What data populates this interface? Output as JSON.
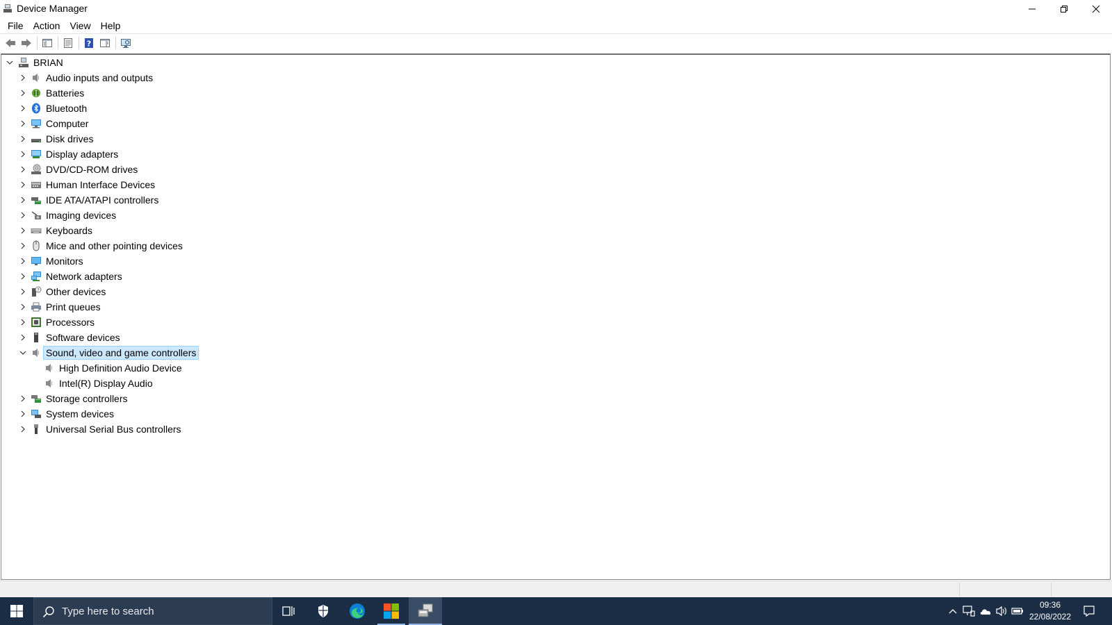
{
  "window": {
    "title": "Device Manager",
    "icon": "device-manager-icon"
  },
  "menu": {
    "items": [
      "File",
      "Action",
      "View",
      "Help"
    ]
  },
  "toolbar": {
    "buttons": [
      "back-arrow-icon",
      "forward-arrow-icon",
      "show-hide-console-tree-icon",
      "properties-icon",
      "help-icon",
      "show-action-pane-icon",
      "scan-hardware-icon"
    ]
  },
  "tree": {
    "root": {
      "label": "BRIAN",
      "icon": "computer-root-icon",
      "expanded": true
    },
    "categories": [
      {
        "label": "Audio inputs and outputs",
        "icon": "speaker-icon"
      },
      {
        "label": "Batteries",
        "icon": "battery-icon"
      },
      {
        "label": "Bluetooth",
        "icon": "bluetooth-icon"
      },
      {
        "label": "Computer",
        "icon": "computer-icon"
      },
      {
        "label": "Disk drives",
        "icon": "disk-drive-icon"
      },
      {
        "label": "Display adapters",
        "icon": "display-adapter-icon"
      },
      {
        "label": "DVD/CD-ROM drives",
        "icon": "dvd-drive-icon"
      },
      {
        "label": "Human Interface Devices",
        "icon": "hid-icon"
      },
      {
        "label": "IDE ATA/ATAPI controllers",
        "icon": "ide-controller-icon"
      },
      {
        "label": "Imaging devices",
        "icon": "camera-icon"
      },
      {
        "label": "Keyboards",
        "icon": "keyboard-icon"
      },
      {
        "label": "Mice and other pointing devices",
        "icon": "mouse-icon"
      },
      {
        "label": "Monitors",
        "icon": "monitor-icon"
      },
      {
        "label": "Network adapters",
        "icon": "network-adapter-icon"
      },
      {
        "label": "Other devices",
        "icon": "unknown-device-icon"
      },
      {
        "label": "Print queues",
        "icon": "printer-icon"
      },
      {
        "label": "Processors",
        "icon": "processor-icon"
      },
      {
        "label": "Software devices",
        "icon": "software-device-icon"
      },
      {
        "label": "Sound, video and game controllers",
        "icon": "speaker-icon",
        "expanded": true,
        "selected": true,
        "children": [
          {
            "label": "High Definition Audio Device",
            "icon": "speaker-icon"
          },
          {
            "label": "Intel(R) Display Audio",
            "icon": "speaker-icon"
          }
        ]
      },
      {
        "label": "Storage controllers",
        "icon": "storage-controller-icon"
      },
      {
        "label": "System devices",
        "icon": "system-device-icon"
      },
      {
        "label": "Universal Serial Bus controllers",
        "icon": "usb-icon"
      }
    ]
  },
  "taskbar": {
    "search_placeholder": "Type here to search",
    "time": "09:36",
    "date": "22/08/2022",
    "apps": [
      "start-icon",
      "task-view-icon",
      "security-shield-icon",
      "edge-icon",
      "store-icon",
      "device-manager-taskbar-icon"
    ],
    "tray": [
      "chevron-up-icon",
      "network-icon",
      "onedrive-icon",
      "volume-icon",
      "battery-tray-icon",
      "notification-icon"
    ]
  },
  "colors": {
    "selection_bg": "#cce8ff",
    "selection_border": "#99d1ff",
    "taskbar_bg": "#1c2e45"
  }
}
